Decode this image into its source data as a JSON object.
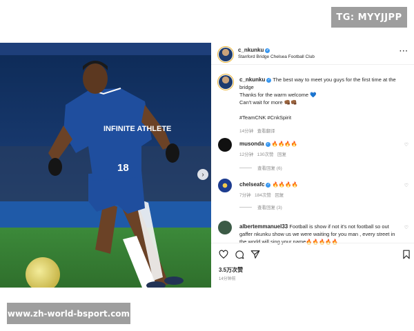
{
  "watermark_top": "TG: MYYJJPP",
  "watermark_bottom": "www.zh-world-bsport.com",
  "photo": {
    "sponsor": "INFINITE ATHLETE",
    "shirt_number": "18"
  },
  "header": {
    "username": "c_nkunku",
    "location": "Stanford Bridge Chelsea Football Club",
    "more": "···"
  },
  "caption": {
    "username": "c_nkunku",
    "line1": "The best way to meet you guys for the first time at the bridge",
    "line2": "Thanks for the warm welcome 💙",
    "line3": "Can't wait for more 👊🏾👊🏾",
    "hashtags": "#TeamCNK #CnkSpirit",
    "time": "14分钟",
    "translate": "查看翻译"
  },
  "comments": [
    {
      "username": "musonda",
      "text": "🔥🔥🔥🔥",
      "time": "12分钟",
      "likes": "130次赞",
      "reply": "回复",
      "view_replies": "查看回复 (6)"
    },
    {
      "username": "chelseafc",
      "text": "🔥🔥🔥🔥",
      "time": "7分钟",
      "likes": "184次赞",
      "reply": "回复",
      "view_replies": "查看回复 (3)"
    },
    {
      "username": "albertemmanuel33",
      "text": "Football is show if not it's not football so out gaffer nkunku show us we were waiting for you man , every street in the world will sing your name🔥🔥🔥🔥🔥"
    }
  ],
  "footer": {
    "likes": "3.5万次赞",
    "time": "14分钟前"
  },
  "colors": {
    "chelsea_blue": "#1f4e9e",
    "verified": "#3897f0",
    "pitch": "#3f8a3a"
  }
}
